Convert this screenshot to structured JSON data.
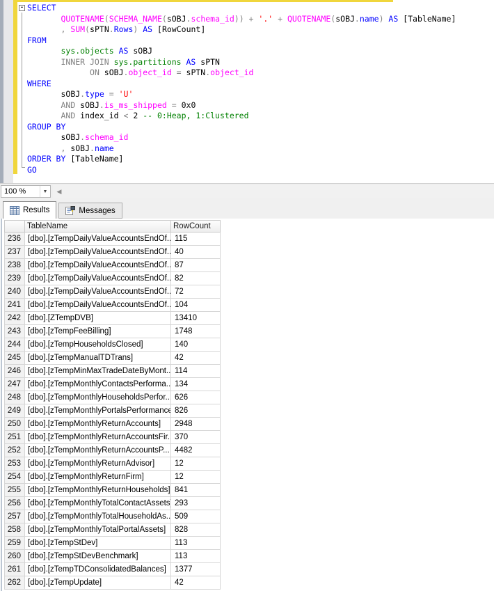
{
  "colors": {
    "keyword": "#0000ff",
    "function": "#ff00ff",
    "string": "#ff0000",
    "comment": "#008000",
    "system_object": "#008000",
    "operator": "#808080",
    "identifier": "#000000",
    "change_bar": "#f0d63c",
    "grid_line": "#d6d6d6"
  },
  "editor": {
    "fold_glyph": "-",
    "lines": [
      {
        "tokens": [
          [
            "k",
            "SELECT"
          ]
        ]
      },
      {
        "tokens": [
          [
            "w",
            "       "
          ],
          [
            "f",
            "QUOTENAME"
          ],
          [
            "o",
            "("
          ],
          [
            "f",
            "SCHEMA_NAME"
          ],
          [
            "o",
            "("
          ],
          [
            "i",
            "sOBJ"
          ],
          [
            "o",
            "."
          ],
          [
            "f",
            "schema_id"
          ],
          [
            "o",
            ")) + "
          ],
          [
            "s",
            "'.'"
          ],
          [
            "o",
            " + "
          ],
          [
            "f",
            "QUOTENAME"
          ],
          [
            "o",
            "("
          ],
          [
            "i",
            "sOBJ"
          ],
          [
            "o",
            "."
          ],
          [
            "k",
            "name"
          ],
          [
            "o",
            ") "
          ],
          [
            "k",
            "AS"
          ],
          [
            "i",
            " [TableName]"
          ]
        ]
      },
      {
        "tokens": [
          [
            "w",
            "       "
          ],
          [
            "o",
            ", "
          ],
          [
            "f",
            "SUM"
          ],
          [
            "o",
            "("
          ],
          [
            "i",
            "sPTN"
          ],
          [
            "o",
            "."
          ],
          [
            "k",
            "Rows"
          ],
          [
            "o",
            ") "
          ],
          [
            "k",
            "AS"
          ],
          [
            "i",
            " [RowCount]"
          ]
        ]
      },
      {
        "tokens": [
          [
            "k",
            "FROM"
          ]
        ]
      },
      {
        "tokens": [
          [
            "w",
            "       "
          ],
          [
            "g",
            "sys.objects"
          ],
          [
            "k",
            " AS"
          ],
          [
            "i",
            " sOBJ"
          ]
        ]
      },
      {
        "tokens": [
          [
            "w",
            "       "
          ],
          [
            "o",
            "INNER JOIN "
          ],
          [
            "g",
            "sys.partitions"
          ],
          [
            "k",
            " AS"
          ],
          [
            "i",
            " sPTN"
          ]
        ]
      },
      {
        "tokens": [
          [
            "w",
            "             "
          ],
          [
            "o",
            "ON "
          ],
          [
            "i",
            "sOBJ"
          ],
          [
            "o",
            "."
          ],
          [
            "f",
            "object_id"
          ],
          [
            "o",
            " = "
          ],
          [
            "i",
            "sPTN"
          ],
          [
            "o",
            "."
          ],
          [
            "f",
            "object_id"
          ]
        ]
      },
      {
        "tokens": [
          [
            "k",
            "WHERE"
          ]
        ]
      },
      {
        "tokens": [
          [
            "w",
            "       "
          ],
          [
            "i",
            "sOBJ"
          ],
          [
            "o",
            "."
          ],
          [
            "k",
            "type"
          ],
          [
            "o",
            " = "
          ],
          [
            "s",
            "'U'"
          ]
        ]
      },
      {
        "tokens": [
          [
            "w",
            "       "
          ],
          [
            "o",
            "AND "
          ],
          [
            "i",
            "sOBJ"
          ],
          [
            "o",
            "."
          ],
          [
            "f",
            "is_ms_shipped"
          ],
          [
            "o",
            " = "
          ],
          [
            "i",
            "0x0"
          ]
        ]
      },
      {
        "tokens": [
          [
            "w",
            "       "
          ],
          [
            "o",
            "AND "
          ],
          [
            "i",
            "index_id"
          ],
          [
            "o",
            " < "
          ],
          [
            "i",
            "2 "
          ],
          [
            "c",
            "-- 0:Heap, 1:Clustered"
          ]
        ]
      },
      {
        "tokens": [
          [
            "k",
            "GROUP BY"
          ]
        ]
      },
      {
        "tokens": [
          [
            "w",
            "       "
          ],
          [
            "i",
            "sOBJ"
          ],
          [
            "o",
            "."
          ],
          [
            "f",
            "schema_id"
          ]
        ]
      },
      {
        "tokens": [
          [
            "w",
            "       "
          ],
          [
            "o",
            ", "
          ],
          [
            "i",
            "sOBJ"
          ],
          [
            "o",
            "."
          ],
          [
            "k",
            "name"
          ]
        ]
      },
      {
        "tokens": [
          [
            "k",
            "ORDER BY"
          ],
          [
            "i",
            " [TableName]"
          ]
        ]
      },
      {
        "tokens": [
          [
            "k",
            "GO"
          ]
        ]
      }
    ]
  },
  "zoom_control": {
    "value": "100 %",
    "dropdown_icon": "chevron-down-icon",
    "scroll_left_icon": "arrow-left-icon"
  },
  "results": {
    "tabs": [
      {
        "label": "Results",
        "icon": "results-grid-icon",
        "active": true
      },
      {
        "label": "Messages",
        "icon": "messages-icon",
        "active": false
      }
    ],
    "columns": {
      "table_name": "TableName",
      "row_count": "RowCount"
    },
    "rows": [
      [
        "236",
        "[dbo].[zTempDailyValueAccountsEndOf...",
        "115"
      ],
      [
        "237",
        "[dbo].[zTempDailyValueAccountsEndOf...",
        "40"
      ],
      [
        "238",
        "[dbo].[zTempDailyValueAccountsEndOf...",
        "87"
      ],
      [
        "239",
        "[dbo].[zTempDailyValueAccountsEndOf...",
        "82"
      ],
      [
        "240",
        "[dbo].[zTempDailyValueAccountsEndOf...",
        "72"
      ],
      [
        "241",
        "[dbo].[zTempDailyValueAccountsEndOf...",
        "104"
      ],
      [
        "242",
        "[dbo].[ZTempDVB]",
        "13410"
      ],
      [
        "243",
        "[dbo].[zTempFeeBilling]",
        "1748"
      ],
      [
        "244",
        "[dbo].[zTempHouseholdsClosed]",
        "140"
      ],
      [
        "245",
        "[dbo].[zTempManualTDTrans]",
        "42"
      ],
      [
        "246",
        "[dbo].[zTempMinMaxTradeDateByMont...",
        "114"
      ],
      [
        "247",
        "[dbo].[zTempMonthlyContactsPerforma...",
        "134"
      ],
      [
        "248",
        "[dbo].[zTempMonthlyHouseholdsPerfor...",
        "626"
      ],
      [
        "249",
        "[dbo].[zTempMonthlyPortalsPerformance]",
        "826"
      ],
      [
        "250",
        "[dbo].[zTempMonthlyReturnAccounts]",
        "2948"
      ],
      [
        "251",
        "[dbo].[zTempMonthlyReturnAccountsFir...",
        "370"
      ],
      [
        "252",
        "[dbo].[zTempMonthlyReturnAccountsP...",
        "4482"
      ],
      [
        "253",
        "[dbo].[zTempMonthlyReturnAdvisor]",
        "12"
      ],
      [
        "254",
        "[dbo].[zTempMonthlyReturnFirm]",
        "12"
      ],
      [
        "255",
        "[dbo].[zTempMonthlyReturnHouseholds]",
        "841"
      ],
      [
        "256",
        "[dbo].[zTempMonthlyTotalContactAssets]",
        "293"
      ],
      [
        "257",
        "[dbo].[zTempMonthlyTotalHouseholdAs...",
        "509"
      ],
      [
        "258",
        "[dbo].[zTempMonthlyTotalPortalAssets]",
        "828"
      ],
      [
        "259",
        "[dbo].[zTempStDev]",
        "113"
      ],
      [
        "260",
        "[dbo].[zTempStDevBenchmark]",
        "113"
      ],
      [
        "261",
        "[dbo].[zTempTDConsolidatedBalances]",
        "1377"
      ],
      [
        "262",
        "[dbo].[zTempUpdate]",
        "42"
      ]
    ]
  }
}
